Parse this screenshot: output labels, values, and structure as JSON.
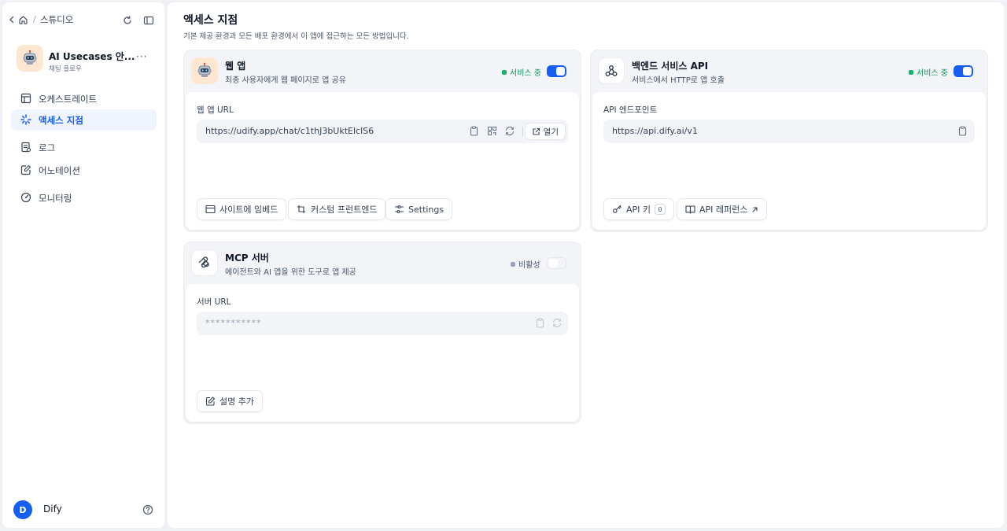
{
  "breadcrumb": {
    "label": "스튜디오"
  },
  "app": {
    "name": "AI Usecases 안...",
    "type": "채팅 플로우",
    "more": "···"
  },
  "nav": [
    {
      "label": "오케스트레이트",
      "icon": "layout-icon"
    },
    {
      "label": "액세스 지점",
      "icon": "access-icon",
      "active": true
    },
    {
      "label": "로그",
      "icon": "log-icon"
    },
    {
      "label": "어노테이션",
      "icon": "annotation-icon"
    },
    {
      "label": "모니터링",
      "icon": "monitoring-icon"
    }
  ],
  "user": {
    "initial": "D",
    "name": "Dify"
  },
  "page": {
    "title": "액세스 지점",
    "subtitle": "기본 제공 환경과 모든 배포 환경에서 이 앱에 접근하는 모든 방법입니다."
  },
  "webapp": {
    "title": "웹 앱",
    "desc": "최종 사용자에게 웹 페이지로 앱 공유",
    "status": "서비스 중",
    "enabled": true,
    "field_label": "웹 앱 URL",
    "url": "https://udify.app/chat/c1thJ3bUktElclS6",
    "open_label": "열기",
    "buttons": {
      "embed": "사이트에 임베드",
      "custom": "커스텀 프런트엔드",
      "settings": "Settings"
    }
  },
  "backend": {
    "title": "백엔드 서비스 API",
    "desc": "서비스에서 HTTP로 앱 호출",
    "status": "서비스 중",
    "enabled": true,
    "field_label": "API 엔드포인트",
    "url": "https://api.dify.ai/v1",
    "buttons": {
      "api_key": "API 키",
      "api_key_count": "0",
      "api_ref": "API 레퍼런스"
    }
  },
  "mcp": {
    "title": "MCP 서버",
    "desc": "에이전트와 AI 앱을 위한 도구로 앱 제공",
    "status": "비활성",
    "enabled": false,
    "field_label": "서버 URL",
    "url": "***********",
    "buttons": {
      "add_desc": "설명 추가"
    }
  },
  "colors": {
    "accent": "#155eef",
    "active_bg": "#eff4ff",
    "status_green": "#17b26a"
  }
}
